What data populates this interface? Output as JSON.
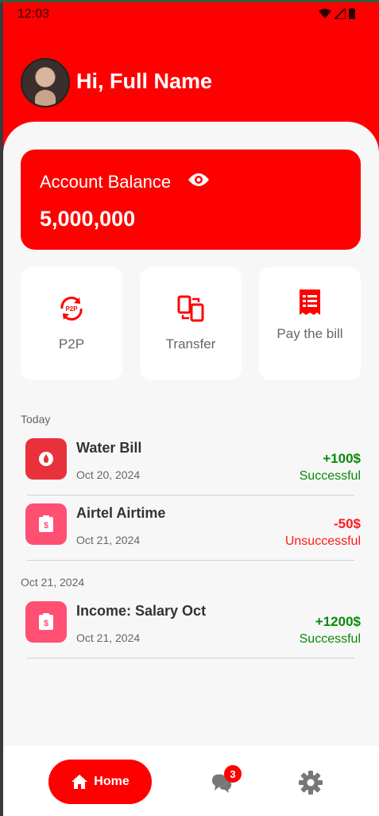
{
  "status_bar": {
    "time": "12:03"
  },
  "header": {
    "greeting": "Hi, Full Name"
  },
  "balance": {
    "label": "Account Balance",
    "value": "5,000,000"
  },
  "actions": [
    {
      "label": "P2P",
      "icon": "p2p-icon"
    },
    {
      "label": "Transfer",
      "icon": "transfer-icon"
    },
    {
      "label": "Pay the bill",
      "icon": "receipt-icon"
    }
  ],
  "sections": [
    {
      "label": "Today",
      "transactions": [
        {
          "title": "Water Bill",
          "date": "Oct 20, 2024",
          "amount": "+100$",
          "status": "Successful",
          "icon": "water-drop-icon"
        },
        {
          "title": "Airtel Airtime",
          "date": "Oct 21, 2024",
          "amount": "-50$",
          "status": "Unsuccessful",
          "icon": "dollar-receipt-icon"
        }
      ]
    },
    {
      "label": "Oct 21, 2024",
      "transactions": [
        {
          "title": "Income: Salary Oct",
          "date": "Oct 21, 2024",
          "amount": "+1200$",
          "status": "Successful",
          "icon": "dollar-receipt-icon"
        }
      ]
    }
  ],
  "nav": {
    "home_label": "Home",
    "chat_badge": "3"
  },
  "colors": {
    "brand": "#ff0000",
    "success": "#0a8a0a",
    "failure": "#ff1a1a"
  }
}
